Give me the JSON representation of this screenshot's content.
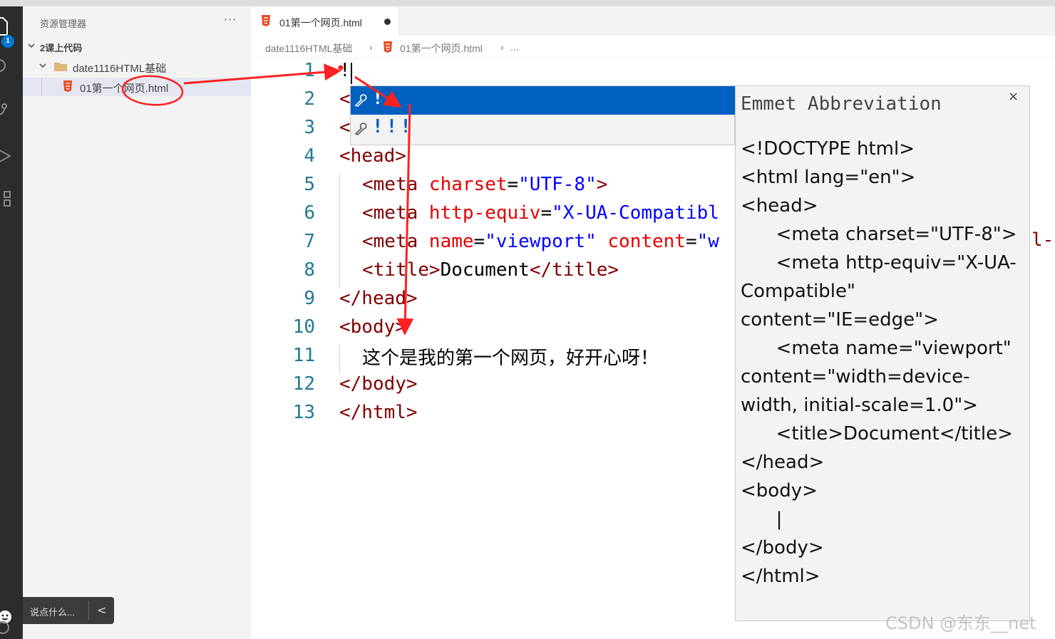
{
  "explorer": {
    "title": "资源管理器",
    "more": "···",
    "workspace": "2课上代码",
    "folder": "date1116HTML基础",
    "file": "01第一个网页.html",
    "badge": "1"
  },
  "chat": {
    "placeholder": "说点什么...",
    "collapse": "<"
  },
  "tab": {
    "label": "01第一个网页.html"
  },
  "breadcrumb": {
    "folder": "date1116HTML基础",
    "file": "01第一个网页.html",
    "tail": "..."
  },
  "editor": {
    "line_numbers": [
      "1",
      "2",
      "3",
      "4",
      "5",
      "6",
      "7",
      "8",
      "9",
      "10",
      "11",
      "12",
      "13"
    ],
    "line1": "!",
    "l2": "<",
    "l3": "<",
    "l4_tag": "<head>",
    "l5_tag": "<meta ",
    "l5_attr": "charset",
    "l5_eq": "=",
    "l5_val": "\"UTF-8\"",
    "l5_end": ">",
    "l6_tag": "<meta ",
    "l6_attr": "http-equiv",
    "l6_eq": "=",
    "l6_val": "\"X-UA-Compatibl",
    "l7_tag": "<meta ",
    "l7_attr": "name",
    "l7_eq": "=",
    "l7_val": "\"viewport\"",
    "l7_attr2": " content",
    "l7_eq2": "=",
    "l7_val2": "\"w",
    "l8_open": "<title>",
    "l8_text": "Document",
    "l8_close": "</title>",
    "l9": "</head>",
    "l10": "<body>",
    "l11": "这个是我的第一个网页，好开心呀！",
    "l12": "</body>",
    "l13": "</html>",
    "overflow": "l-"
  },
  "suggest": {
    "items": [
      "!",
      "!!!"
    ]
  },
  "details": {
    "title": "Emmet Abbreviation",
    "close": "×",
    "lines": [
      "<!DOCTYPE html>",
      "<html lang=\"en\">",
      "<head>",
      "      <meta charset=\"UTF-8\">",
      "      <meta http-equiv=\"X-UA-Compatible\" content=\"IE=edge\">",
      "      <meta name=\"viewport\" content=\"width=device-width, initial-scale=1.0\">",
      "      <title>Document</title>",
      "</head>",
      "<body>",
      "      |",
      "</body>",
      "</html>"
    ]
  },
  "watermark": "CSDN @东东__net",
  "colors": {
    "activity_bar": "#2c2c2c",
    "sidebar": "#f3f3f3",
    "tag": "#800000",
    "attribute": "#e50000",
    "value": "#0000ff",
    "line_number": "#237893",
    "suggest_selected": "#0060c0",
    "annotation": "#ff2020"
  }
}
